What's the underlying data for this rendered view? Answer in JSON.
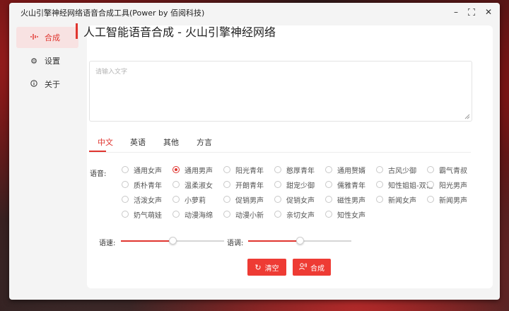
{
  "window": {
    "title": "火山引擎神经网络语音合成工具(Power by 佰阅科技)",
    "controls": [
      "minimize",
      "maximize",
      "close"
    ]
  },
  "sidebar": {
    "items": [
      {
        "label": "合成",
        "icon": "waveform-icon",
        "active": true
      },
      {
        "label": "设置",
        "icon": "gear-icon",
        "active": false
      },
      {
        "label": "关于",
        "icon": "info-icon",
        "active": false
      }
    ]
  },
  "header": {
    "title": "人工智能语音合成 - 火山引擎神经网络"
  },
  "input": {
    "placeholder": "请输入文字",
    "value": ""
  },
  "tabs": [
    {
      "label": "中文",
      "active": true
    },
    {
      "label": "英语",
      "active": false
    },
    {
      "label": "其他",
      "active": false
    },
    {
      "label": "方言",
      "active": false
    }
  ],
  "voices": {
    "label": "语音:",
    "selected": "通用男声",
    "items": [
      "通用女声",
      "通用男声",
      "阳光青年",
      "憨厚青年",
      "通用赘婿",
      "古风少御",
      "霸气青叔",
      "质朴青年",
      "温柔淑女",
      "开朗青年",
      "甜宠少御",
      "儒雅青年",
      "知性姐姐-双语",
      "阳光男声",
      "活泼女声",
      "小萝莉",
      "促销男声",
      "促销女声",
      "磁性男声",
      "新闻女声",
      "新闻男声",
      "奶气萌娃",
      "动漫海绵",
      "动漫小新",
      "亲切女声",
      "知性女声"
    ]
  },
  "sliders": {
    "speed": {
      "label": "语速:",
      "value": 0.5
    },
    "pitch": {
      "label": "语调:",
      "value": 0.5
    }
  },
  "buttons": {
    "clear": {
      "label": "清空",
      "icon": "refresh-icon"
    },
    "synth": {
      "label": "合成",
      "icon": "person-voice-icon"
    }
  },
  "colors": {
    "accent": "#e0352f",
    "button": "#ee3b34"
  }
}
